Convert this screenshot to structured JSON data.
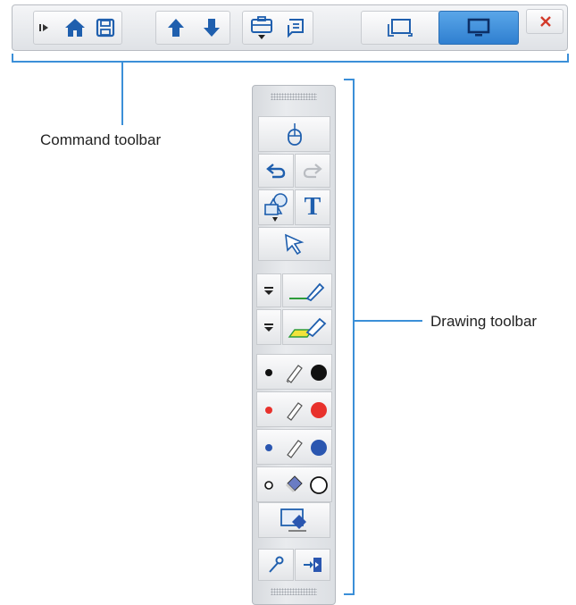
{
  "labels": {
    "command_toolbar": "Command toolbar",
    "drawing_toolbar": "Drawing toolbar"
  },
  "command_toolbar": {
    "buttons": [
      "collapse-icon",
      "home-icon",
      "save-icon",
      "page-up-icon",
      "page-down-icon",
      "toolbox-icon",
      "pages-icon",
      "window-mode-icon",
      "desktop-mode-icon",
      "close-icon"
    ],
    "selected": "desktop-mode-icon"
  },
  "drawing_toolbar": {
    "buttons": [
      "mouse-icon",
      "undo-icon",
      "redo-icon",
      "shapes-icon",
      "text-icon",
      "select-icon",
      "pen-style-icon",
      "highlighter-style-icon",
      "black-pen-icon",
      "red-pen-icon",
      "blue-pen-icon",
      "eraser-icon",
      "clear-screen-icon",
      "pin-icon",
      "exit-icon"
    ],
    "text_tool_glyph": "T",
    "pen_colors": [
      "#111111",
      "#e8312c",
      "#2a56b0"
    ]
  },
  "colors": {
    "accent": "#3b8fd8",
    "selected_button": "#2f7fd0",
    "close": "#d23a2a"
  }
}
